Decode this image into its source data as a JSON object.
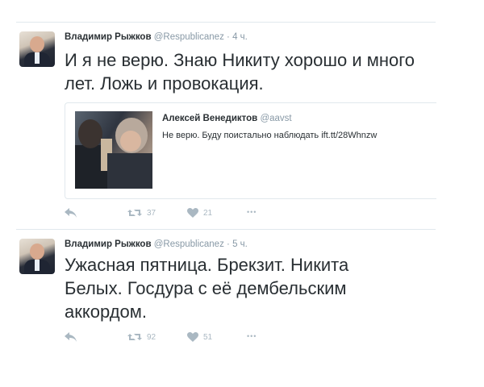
{
  "tweets": [
    {
      "name": "Владимир Рыжков",
      "handle": "@Respublicanez",
      "separator": "·",
      "time": "4 ч.",
      "text": "И я не верю. Знаю Никиту хорошо и много лет. Ложь и провокация.",
      "quote": {
        "name": "Алексей Венедиктов",
        "handle": "@aavst",
        "text": "Не верю. Буду поистально наблюдать",
        "link": "ift.tt/28Whnzw"
      },
      "actions": {
        "reply_icon": "reply-icon",
        "retweet_icon": "retweet-icon",
        "retweets": "37",
        "like_icon": "heart-icon",
        "likes": "21",
        "more": "•••"
      }
    },
    {
      "name": "Владимир Рыжков",
      "handle": "@Respublicanez",
      "separator": "·",
      "time": "5 ч.",
      "text": "Ужасная пятница. Брекзит. Никита Белых. Госдура с её дембельским аккордом.",
      "actions": {
        "reply_icon": "reply-icon",
        "retweet_icon": "retweet-icon",
        "retweets": "92",
        "like_icon": "heart-icon",
        "likes": "51",
        "more": "•••"
      }
    }
  ],
  "colors": {
    "text": "#292f33",
    "muted": "#8899a6",
    "icon": "#aab8c2",
    "border": "#e1e8ed"
  }
}
